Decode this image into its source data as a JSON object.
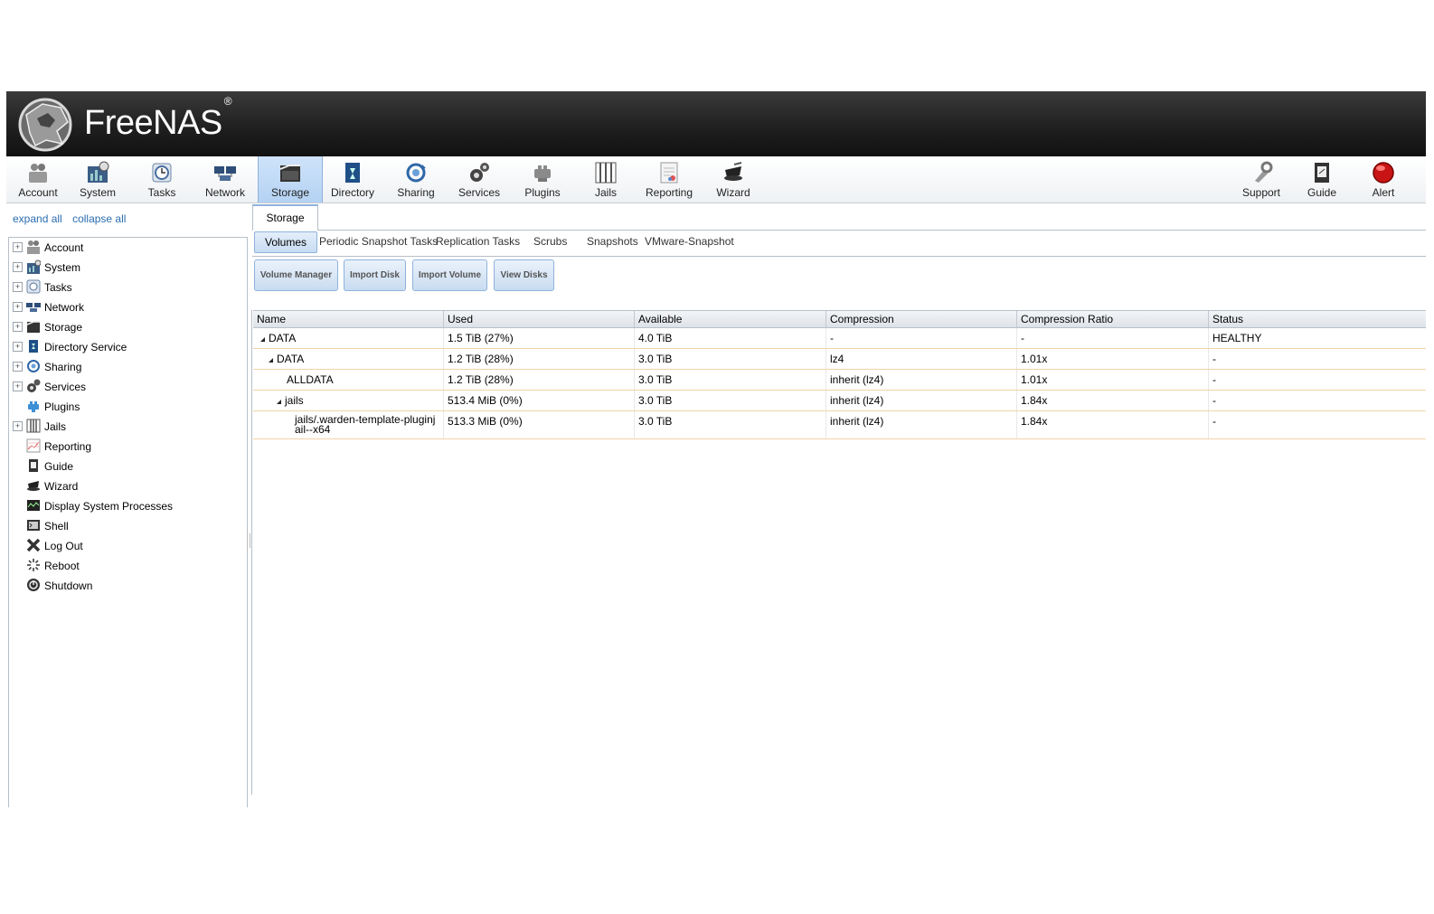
{
  "app": {
    "name": "FreeNAS",
    "trademark": "®"
  },
  "topnav": [
    {
      "label": "Account",
      "icon": "account-icon"
    },
    {
      "label": "System",
      "icon": "system-icon"
    },
    {
      "label": "Tasks",
      "icon": "tasks-icon"
    },
    {
      "label": "Network",
      "icon": "network-icon"
    },
    {
      "label": "Storage",
      "icon": "storage-icon",
      "active": true
    },
    {
      "label": "Directory",
      "icon": "directory-icon"
    },
    {
      "label": "Sharing",
      "icon": "sharing-icon"
    },
    {
      "label": "Services",
      "icon": "services-icon"
    },
    {
      "label": "Plugins",
      "icon": "plugins-icon"
    },
    {
      "label": "Jails",
      "icon": "jails-icon"
    },
    {
      "label": "Reporting",
      "icon": "reporting-icon"
    },
    {
      "label": "Wizard",
      "icon": "wizard-icon"
    }
  ],
  "topnav_right": [
    {
      "label": "Support",
      "icon": "support-icon"
    },
    {
      "label": "Guide",
      "icon": "guide-icon"
    },
    {
      "label": "Alert",
      "icon": "alert-icon"
    }
  ],
  "tree": {
    "expand_all": "expand all",
    "collapse_all": "collapse all",
    "items": [
      {
        "label": "Account",
        "expandable": true
      },
      {
        "label": "System",
        "expandable": true
      },
      {
        "label": "Tasks",
        "expandable": true
      },
      {
        "label": "Network",
        "expandable": true
      },
      {
        "label": "Storage",
        "expandable": true
      },
      {
        "label": "Directory Service",
        "expandable": true
      },
      {
        "label": "Sharing",
        "expandable": true
      },
      {
        "label": "Services",
        "expandable": true
      },
      {
        "label": "Plugins",
        "expandable": false
      },
      {
        "label": "Jails",
        "expandable": true
      },
      {
        "label": "Reporting",
        "expandable": false
      },
      {
        "label": "Guide",
        "expandable": false
      },
      {
        "label": "Wizard",
        "expandable": false
      },
      {
        "label": "Display System Processes",
        "expandable": false
      },
      {
        "label": "Shell",
        "expandable": false
      },
      {
        "label": "Log Out",
        "expandable": false
      },
      {
        "label": "Reboot",
        "expandable": false
      },
      {
        "label": "Shutdown",
        "expandable": false
      }
    ]
  },
  "main": {
    "tab": "Storage",
    "subtabs": [
      "Volumes",
      "Periodic Snapshot Tasks",
      "Replication Tasks",
      "Scrubs",
      "Snapshots",
      "VMware-Snapshot"
    ],
    "buttons": [
      "Volume Manager",
      "Import Disk",
      "Import Volume",
      "View Disks"
    ],
    "columns": [
      "Name",
      "Used",
      "Available",
      "Compression",
      "Compression Ratio",
      "Status"
    ],
    "rows": [
      {
        "name": "DATA",
        "expanded": true,
        "used": "1.5 TiB (27%)",
        "available": "4.0 TiB",
        "compression": "-",
        "ratio": "-",
        "status": "HEALTHY"
      },
      {
        "name": "DATA",
        "expanded": true,
        "used": "1.2 TiB (28%)",
        "available": "3.0 TiB",
        "compression": "lz4",
        "ratio": "1.01x",
        "status": "-"
      },
      {
        "name": "ALLDATA",
        "expanded": false,
        "used": "1.2 TiB (28%)",
        "available": "3.0 TiB",
        "compression": "inherit (lz4)",
        "ratio": "1.01x",
        "status": "-"
      },
      {
        "name": "jails",
        "expanded": true,
        "used": "513.4 MiB (0%)",
        "available": "3.0 TiB",
        "compression": "inherit (lz4)",
        "ratio": "1.84x",
        "status": "-"
      },
      {
        "name": "jails/.warden-template-pluginjail--x64",
        "expanded": false,
        "used": "513.3 MiB (0%)",
        "available": "3.0 TiB",
        "compression": "inherit (lz4)",
        "ratio": "1.84x",
        "status": "-"
      }
    ]
  }
}
